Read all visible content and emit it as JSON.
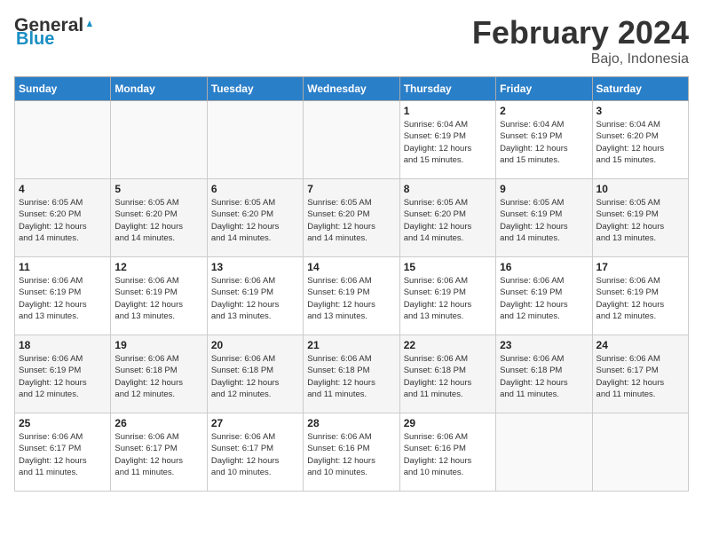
{
  "header": {
    "logo_line1_plain": "General",
    "logo_line1_blue": "Blue",
    "title": "February 2024",
    "location": "Bajo, Indonesia"
  },
  "days_of_week": [
    "Sunday",
    "Monday",
    "Tuesday",
    "Wednesday",
    "Thursday",
    "Friday",
    "Saturday"
  ],
  "weeks": [
    [
      {
        "day": "",
        "info": ""
      },
      {
        "day": "",
        "info": ""
      },
      {
        "day": "",
        "info": ""
      },
      {
        "day": "",
        "info": ""
      },
      {
        "day": "1",
        "info": "Sunrise: 6:04 AM\nSunset: 6:19 PM\nDaylight: 12 hours\nand 15 minutes."
      },
      {
        "day": "2",
        "info": "Sunrise: 6:04 AM\nSunset: 6:19 PM\nDaylight: 12 hours\nand 15 minutes."
      },
      {
        "day": "3",
        "info": "Sunrise: 6:04 AM\nSunset: 6:20 PM\nDaylight: 12 hours\nand 15 minutes."
      }
    ],
    [
      {
        "day": "4",
        "info": "Sunrise: 6:05 AM\nSunset: 6:20 PM\nDaylight: 12 hours\nand 14 minutes."
      },
      {
        "day": "5",
        "info": "Sunrise: 6:05 AM\nSunset: 6:20 PM\nDaylight: 12 hours\nand 14 minutes."
      },
      {
        "day": "6",
        "info": "Sunrise: 6:05 AM\nSunset: 6:20 PM\nDaylight: 12 hours\nand 14 minutes."
      },
      {
        "day": "7",
        "info": "Sunrise: 6:05 AM\nSunset: 6:20 PM\nDaylight: 12 hours\nand 14 minutes."
      },
      {
        "day": "8",
        "info": "Sunrise: 6:05 AM\nSunset: 6:20 PM\nDaylight: 12 hours\nand 14 minutes."
      },
      {
        "day": "9",
        "info": "Sunrise: 6:05 AM\nSunset: 6:19 PM\nDaylight: 12 hours\nand 14 minutes."
      },
      {
        "day": "10",
        "info": "Sunrise: 6:05 AM\nSunset: 6:19 PM\nDaylight: 12 hours\nand 13 minutes."
      }
    ],
    [
      {
        "day": "11",
        "info": "Sunrise: 6:06 AM\nSunset: 6:19 PM\nDaylight: 12 hours\nand 13 minutes."
      },
      {
        "day": "12",
        "info": "Sunrise: 6:06 AM\nSunset: 6:19 PM\nDaylight: 12 hours\nand 13 minutes."
      },
      {
        "day": "13",
        "info": "Sunrise: 6:06 AM\nSunset: 6:19 PM\nDaylight: 12 hours\nand 13 minutes."
      },
      {
        "day": "14",
        "info": "Sunrise: 6:06 AM\nSunset: 6:19 PM\nDaylight: 12 hours\nand 13 minutes."
      },
      {
        "day": "15",
        "info": "Sunrise: 6:06 AM\nSunset: 6:19 PM\nDaylight: 12 hours\nand 13 minutes."
      },
      {
        "day": "16",
        "info": "Sunrise: 6:06 AM\nSunset: 6:19 PM\nDaylight: 12 hours\nand 12 minutes."
      },
      {
        "day": "17",
        "info": "Sunrise: 6:06 AM\nSunset: 6:19 PM\nDaylight: 12 hours\nand 12 minutes."
      }
    ],
    [
      {
        "day": "18",
        "info": "Sunrise: 6:06 AM\nSunset: 6:19 PM\nDaylight: 12 hours\nand 12 minutes."
      },
      {
        "day": "19",
        "info": "Sunrise: 6:06 AM\nSunset: 6:18 PM\nDaylight: 12 hours\nand 12 minutes."
      },
      {
        "day": "20",
        "info": "Sunrise: 6:06 AM\nSunset: 6:18 PM\nDaylight: 12 hours\nand 12 minutes."
      },
      {
        "day": "21",
        "info": "Sunrise: 6:06 AM\nSunset: 6:18 PM\nDaylight: 12 hours\nand 11 minutes."
      },
      {
        "day": "22",
        "info": "Sunrise: 6:06 AM\nSunset: 6:18 PM\nDaylight: 12 hours\nand 11 minutes."
      },
      {
        "day": "23",
        "info": "Sunrise: 6:06 AM\nSunset: 6:18 PM\nDaylight: 12 hours\nand 11 minutes."
      },
      {
        "day": "24",
        "info": "Sunrise: 6:06 AM\nSunset: 6:17 PM\nDaylight: 12 hours\nand 11 minutes."
      }
    ],
    [
      {
        "day": "25",
        "info": "Sunrise: 6:06 AM\nSunset: 6:17 PM\nDaylight: 12 hours\nand 11 minutes."
      },
      {
        "day": "26",
        "info": "Sunrise: 6:06 AM\nSunset: 6:17 PM\nDaylight: 12 hours\nand 11 minutes."
      },
      {
        "day": "27",
        "info": "Sunrise: 6:06 AM\nSunset: 6:17 PM\nDaylight: 12 hours\nand 10 minutes."
      },
      {
        "day": "28",
        "info": "Sunrise: 6:06 AM\nSunset: 6:16 PM\nDaylight: 12 hours\nand 10 minutes."
      },
      {
        "day": "29",
        "info": "Sunrise: 6:06 AM\nSunset: 6:16 PM\nDaylight: 12 hours\nand 10 minutes."
      },
      {
        "day": "",
        "info": ""
      },
      {
        "day": "",
        "info": ""
      }
    ]
  ]
}
